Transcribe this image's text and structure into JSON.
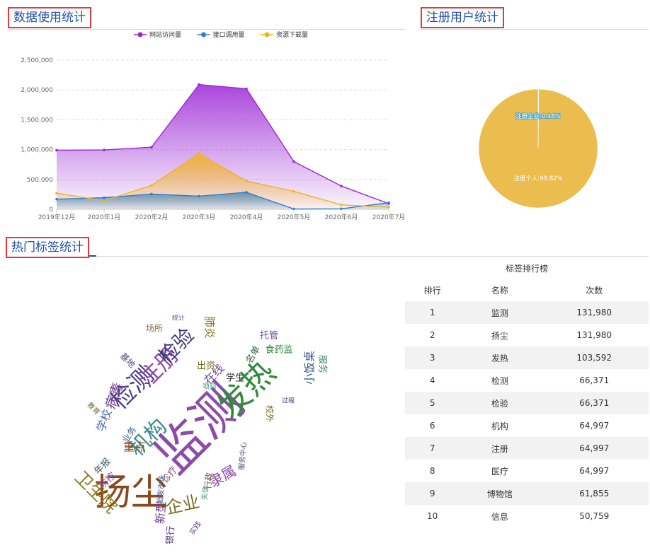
{
  "sections": {
    "usage_title": "数据使用统计",
    "users_title": "注册用户统计",
    "tags_title": "热门标签统计"
  },
  "chart_data": [
    {
      "type": "area",
      "categories": [
        "2019年12月",
        "2020年1月",
        "2020年2月",
        "2020年3月",
        "2020年4月",
        "2020年5月",
        "2020年6月",
        "2020年7月"
      ],
      "series": [
        {
          "name": "网站访问量",
          "color": "#9b25d6",
          "values": [
            990000,
            995000,
            1040000,
            2090000,
            2020000,
            800000,
            390000,
            95000
          ]
        },
        {
          "name": "接口调用量",
          "color": "#2a7fd6",
          "values": [
            170000,
            195000,
            255000,
            220000,
            285000,
            5000,
            8000,
            110000
          ]
        },
        {
          "name": "资源下载量",
          "color": "#f2b31b",
          "values": [
            270000,
            145000,
            400000,
            935000,
            475000,
            300000,
            75000,
            35000
          ]
        }
      ],
      "y_ticks": [
        "0",
        "500,000",
        "1,000,000",
        "1,500,000",
        "2,000,000",
        "2,500,000"
      ],
      "ylim": [
        0,
        2500000
      ],
      "legend_position": "top-center",
      "grid": true
    },
    {
      "type": "pie",
      "slices": [
        {
          "label": "注册企业:0.18%",
          "value": 0.18,
          "color": "#4da6c8"
        },
        {
          "label": "注册个人:99.82%",
          "value": 99.82,
          "color": "#ebbd4f"
        }
      ]
    },
    {
      "type": "table",
      "title": "标签排行榜",
      "headers": [
        "排行",
        "名称",
        "次数"
      ],
      "rows": [
        [
          "1",
          "监测",
          "131,980"
        ],
        [
          "2",
          "扬尘",
          "131,980"
        ],
        [
          "3",
          "发热",
          "103,592"
        ],
        [
          "4",
          "检测",
          "66,371"
        ],
        [
          "5",
          "检验",
          "66,371"
        ],
        [
          "6",
          "机构",
          "64,997"
        ],
        [
          "7",
          "注册",
          "64,997"
        ],
        [
          "8",
          "医疗",
          "64,997"
        ],
        [
          "9",
          "博物馆",
          "61,855"
        ],
        [
          "10",
          "信息",
          "50,759"
        ]
      ]
    }
  ],
  "word_cloud": [
    {
      "text": "监测",
      "color": "#8e4aa8"
    },
    {
      "text": "扬尘",
      "color": "#8a4a1c"
    },
    {
      "text": "发热",
      "color": "#2e8b3a"
    },
    {
      "text": "检测",
      "color": "#4a3a8a"
    },
    {
      "text": "注册",
      "color": "#8e4aa8"
    },
    {
      "text": "检验",
      "color": "#3a3a7a"
    },
    {
      "text": "机构",
      "color": "#3b8a8a"
    },
    {
      "text": "卫生院",
      "color": "#8a7a1c"
    },
    {
      "text": "企业",
      "color": "#7a6a1c"
    },
    {
      "text": "病毒",
      "color": "#6a3a8a"
    },
    {
      "text": "学校",
      "color": "#4a6aa8"
    },
    {
      "text": "重点",
      "color": "#8a4a1c"
    },
    {
      "text": "在线",
      "color": "#6a4a8a"
    },
    {
      "text": "学生",
      "color": "#333333"
    },
    {
      "text": "托管",
      "color": "#6a4a8a"
    },
    {
      "text": "食药监",
      "color": "#2e8b3a"
    },
    {
      "text": "名单",
      "color": "#2e6a3a"
    },
    {
      "text": "肺炎",
      "color": "#8a7a1c"
    },
    {
      "text": "场所",
      "color": "#7a6a3a"
    },
    {
      "text": "基地",
      "color": "#4a4a7a"
    },
    {
      "text": "出资",
      "color": "#7a6a1c"
    },
    {
      "text": "隶属",
      "color": "#8e4aa8"
    },
    {
      "text": "新型",
      "color": "#6a3a8a"
    },
    {
      "text": "银行",
      "color": "#4a3a7a"
    },
    {
      "text": "小饭桌",
      "color": "#3a5a8a"
    },
    {
      "text": "服务",
      "color": "#3b8a6a"
    },
    {
      "text": "校外",
      "color": "#7a6a1c"
    },
    {
      "text": "业务",
      "color": "#3a5a8a"
    },
    {
      "text": "年报",
      "color": "#3a5a6a"
    },
    {
      "text": "防控",
      "color": "#8e4aa8"
    },
    {
      "text": "项目",
      "color": "#3b8a8a"
    },
    {
      "text": "统计",
      "color": "#3a5a8a"
    },
    {
      "text": "行政",
      "color": "#6a5a3a"
    },
    {
      "text": "诊疗",
      "color": "#8a4a6a"
    },
    {
      "text": "批发市场",
      "color": "#3a5a8a"
    },
    {
      "text": "服务中心",
      "color": "#4a4a7a"
    },
    {
      "text": "失信",
      "color": "#3b8a6a"
    },
    {
      "text": "教育",
      "color": "#7a6a3a"
    },
    {
      "text": "实践",
      "color": "#6a3a8a"
    },
    {
      "text": "过程",
      "color": "#3a3a7a"
    }
  ]
}
